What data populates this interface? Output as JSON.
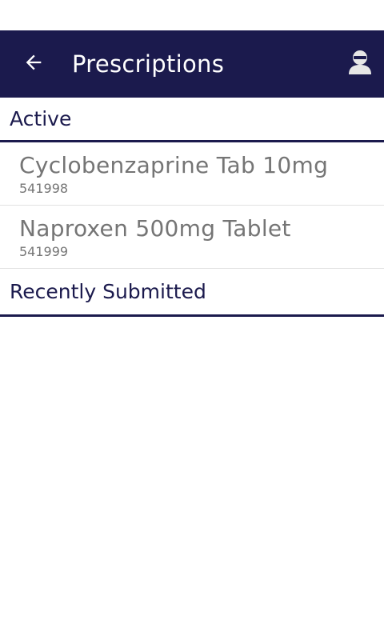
{
  "header": {
    "title": "Prescriptions",
    "back_icon": "arrow-left-icon",
    "profile_icon": "user-profile-icon",
    "bg_color": "#1b1a4d"
  },
  "sections": {
    "active": {
      "label": "Active",
      "items": [
        {
          "name": "Cyclobenzaprine Tab 10mg",
          "rx_number": "541998"
        },
        {
          "name": "Naproxen 500mg Tablet",
          "rx_number": "541999"
        }
      ]
    },
    "recent": {
      "label": "Recently Submitted",
      "items": []
    }
  }
}
